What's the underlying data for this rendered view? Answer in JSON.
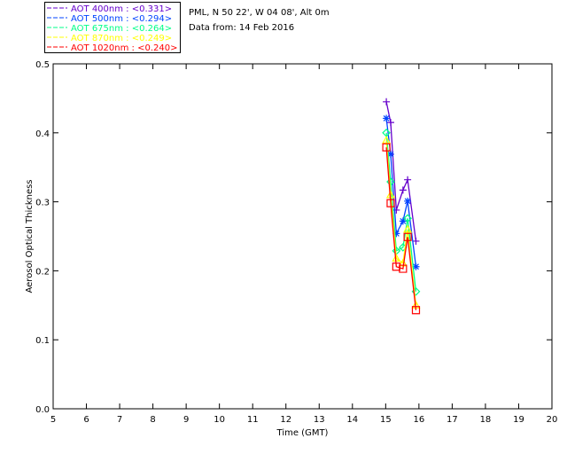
{
  "chart_data": {
    "type": "line",
    "info_lines": [
      "PML, N 50 22', W 04 08', Alt 0m",
      "Data from: 14 Feb 2016"
    ],
    "xlabel": "Time (GMT)",
    "ylabel": "Aerosol Optical Thickness",
    "xlim": [
      5,
      20
    ],
    "ylim": [
      0,
      0.5
    ],
    "xticks": [
      5,
      6,
      7,
      8,
      9,
      10,
      11,
      12,
      13,
      14,
      15,
      16,
      17,
      18,
      19,
      20
    ],
    "yticks": [
      "0.0",
      "0.1",
      "0.2",
      "0.3",
      "0.4",
      "0.5"
    ],
    "grid": false,
    "legend_position": "top-left-outside",
    "x": [
      15.02,
      15.15,
      15.32,
      15.52,
      15.66,
      15.91
    ],
    "series": [
      {
        "name": "AOT  400nm : <0.331>",
        "color": "#6600cc",
        "marker": "plus",
        "values": [
          0.445,
          0.415,
          0.288,
          0.317,
          0.332,
          0.243
        ]
      },
      {
        "name": "AOT  500nm : <0.294>",
        "color": "#0044ff",
        "marker": "asterisk",
        "values": [
          0.421,
          0.369,
          0.254,
          0.272,
          0.301,
          0.206
        ]
      },
      {
        "name": "AOT  675nm : <0.264>",
        "color": "#00ff88",
        "marker": "diamond",
        "values": [
          0.4,
          0.329,
          0.229,
          0.234,
          0.276,
          0.17
        ]
      },
      {
        "name": "AOT  870nm : <0.249>",
        "color": "#ffff00",
        "marker": "triangle",
        "values": [
          0.389,
          0.31,
          0.218,
          0.211,
          0.26,
          0.15
        ]
      },
      {
        "name": "AOT 1020nm : <0.240>",
        "color": "#ff0000",
        "marker": "square",
        "values": [
          0.379,
          0.298,
          0.206,
          0.203,
          0.249,
          0.143
        ]
      }
    ]
  }
}
